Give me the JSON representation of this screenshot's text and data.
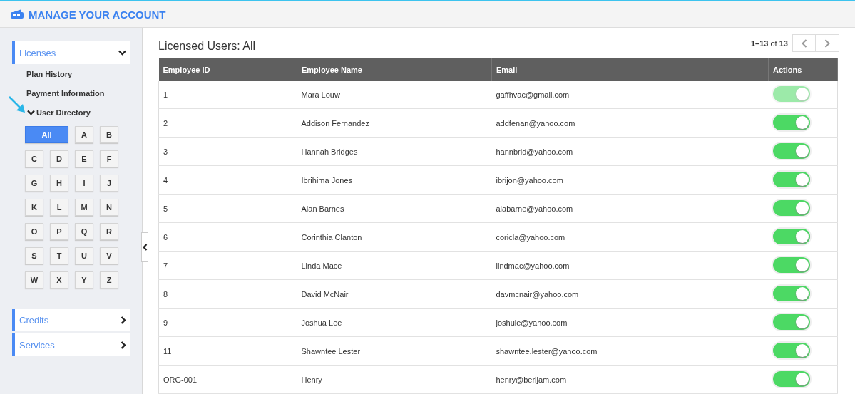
{
  "header": {
    "title": "MANAGE YOUR ACCOUNT"
  },
  "sidebar": {
    "sections": [
      {
        "label": "Licenses",
        "expanded": true,
        "items": [
          {
            "label": "Plan History",
            "kind": "link"
          },
          {
            "label": "Payment Information",
            "kind": "link"
          },
          {
            "label": "User Directory",
            "kind": "expander",
            "expanded": true
          }
        ]
      },
      {
        "label": "Credits",
        "expanded": false
      },
      {
        "label": "Services",
        "expanded": false
      }
    ],
    "letters": [
      {
        "label": "All",
        "selected": true
      },
      {
        "label": "A",
        "selected": false
      },
      {
        "label": "B",
        "selected": false
      },
      {
        "label": "C",
        "selected": false
      },
      {
        "label": "D",
        "selected": false
      },
      {
        "label": "E",
        "selected": false
      },
      {
        "label": "F",
        "selected": false
      },
      {
        "label": "G",
        "selected": false
      },
      {
        "label": "H",
        "selected": false
      },
      {
        "label": "I",
        "selected": false
      },
      {
        "label": "J",
        "selected": false
      },
      {
        "label": "K",
        "selected": false
      },
      {
        "label": "L",
        "selected": false
      },
      {
        "label": "M",
        "selected": false
      },
      {
        "label": "N",
        "selected": false
      },
      {
        "label": "O",
        "selected": false
      },
      {
        "label": "P",
        "selected": false
      },
      {
        "label": "Q",
        "selected": false
      },
      {
        "label": "R",
        "selected": false
      },
      {
        "label": "S",
        "selected": false
      },
      {
        "label": "T",
        "selected": false
      },
      {
        "label": "U",
        "selected": false
      },
      {
        "label": "V",
        "selected": false
      },
      {
        "label": "W",
        "selected": false
      },
      {
        "label": "X",
        "selected": false
      },
      {
        "label": "Y",
        "selected": false
      },
      {
        "label": "Z",
        "selected": false
      }
    ]
  },
  "main": {
    "title": "Licensed Users: All",
    "pagination": {
      "range": "1–13",
      "of": "of",
      "total": "13"
    },
    "table": {
      "columns": [
        "Employee ID",
        "Employee Name",
        "Email",
        "Actions"
      ],
      "rows": [
        {
          "id": "1",
          "name": "Mara Louw",
          "email": "gaffhvac@gmail.com",
          "on": true,
          "disabled": true
        },
        {
          "id": "2",
          "name": "Addison Fernandez",
          "email": "addfenan@yahoo.com",
          "on": true,
          "disabled": false
        },
        {
          "id": "3",
          "name": "Hannah Bridges",
          "email": "hannbrid@yahoo.com",
          "on": true,
          "disabled": false
        },
        {
          "id": "4",
          "name": "Ibrihima Jones",
          "email": "ibrijon@yahoo.com",
          "on": true,
          "disabled": false
        },
        {
          "id": "5",
          "name": "Alan Barnes",
          "email": "alabarne@yahoo.com",
          "on": true,
          "disabled": false
        },
        {
          "id": "6",
          "name": "Corinthia Clanton",
          "email": "coricla@yahoo.com",
          "on": true,
          "disabled": false
        },
        {
          "id": "7",
          "name": "Linda Mace",
          "email": "lindmac@yahoo.com",
          "on": true,
          "disabled": false
        },
        {
          "id": "8",
          "name": "David McNair",
          "email": "davmcnair@yahoo.com",
          "on": true,
          "disabled": false
        },
        {
          "id": "9",
          "name": "Joshua Lee",
          "email": "joshule@yahoo.com",
          "on": true,
          "disabled": false
        },
        {
          "id": "11",
          "name": "Shawntee Lester",
          "email": "shawntee.lester@yahoo.com",
          "on": true,
          "disabled": false
        },
        {
          "id": "ORG-001",
          "name": "Henry",
          "email": "henry@berijam.com",
          "on": true,
          "disabled": false
        }
      ]
    }
  }
}
